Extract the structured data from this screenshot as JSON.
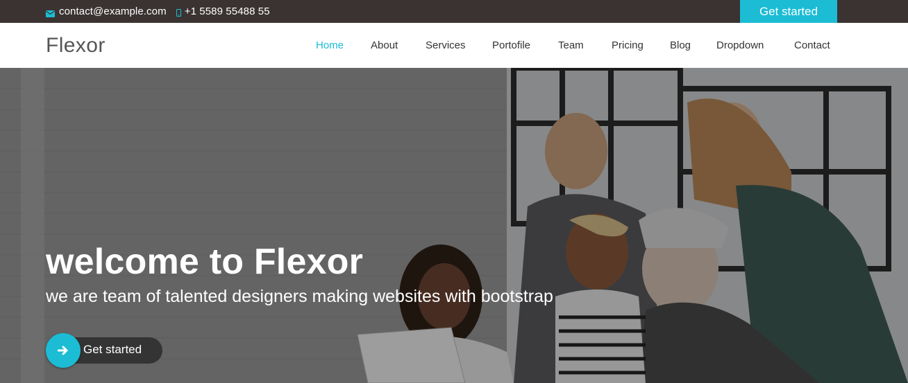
{
  "topbar": {
    "email": "contact@example.com",
    "phone": "+1 5589 55488 55",
    "cta_label": "Get started",
    "email_icon": "envelope-icon",
    "phone_icon": "mobile-phone-icon"
  },
  "header": {
    "logo": "Flexor",
    "nav": [
      {
        "label": "Home",
        "active": true
      },
      {
        "label": "About"
      },
      {
        "label": "Services"
      },
      {
        "label": "Portofile"
      },
      {
        "label": "Team"
      },
      {
        "label": "Pricing"
      },
      {
        "label": "Blog"
      },
      {
        "label": "Dropdown"
      },
      {
        "label": "Contact"
      }
    ]
  },
  "hero": {
    "title": "welcome to Flexor",
    "subtitle": "we are team of talented designers making websites with bootstrap",
    "cta_label": "Get started",
    "cta_icon": "arrow-right-icon"
  },
  "colors": {
    "accent": "#1bbcd4",
    "topbar": "#3a3332",
    "nav_text": "#333333",
    "logo_text": "#555555"
  }
}
